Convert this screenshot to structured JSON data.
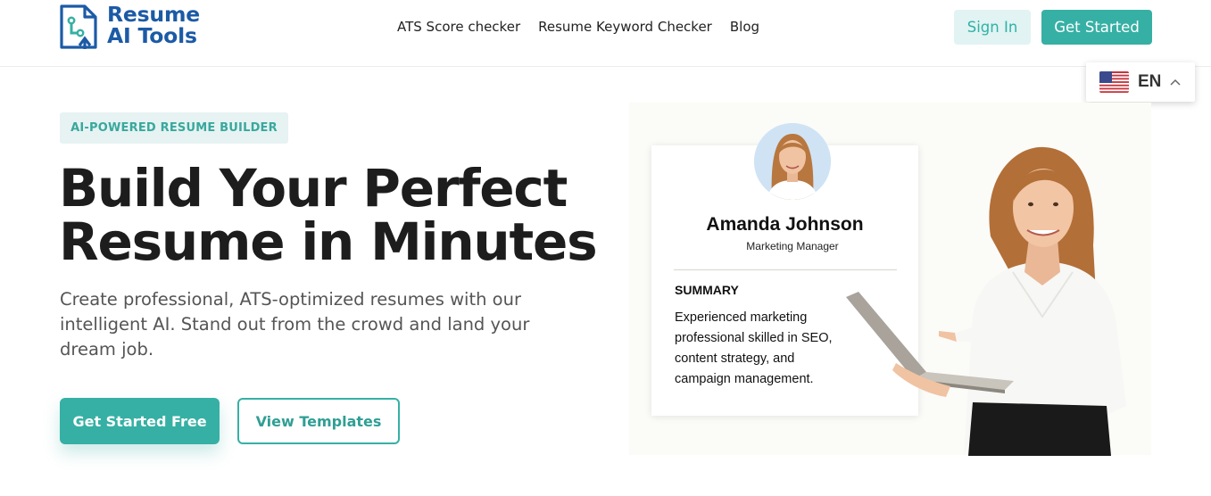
{
  "header": {
    "logo_line1": "Resume",
    "logo_line2": "AI Tools",
    "nav": [
      "ATS Score checker",
      "Resume Keyword Checker",
      "Blog"
    ],
    "sign_in": "Sign In",
    "get_started": "Get Started"
  },
  "language": {
    "code": "EN"
  },
  "hero": {
    "badge": "AI-POWERED RESUME BUILDER",
    "headline_line1": "Build Your Perfect",
    "headline_line2": "Resume in Minutes",
    "subtitle": "Create professional, ATS-optimized resumes with our intelligent AI. Stand out from the crowd and land your dream job.",
    "cta_primary": "Get Started Free",
    "cta_secondary": "View Templates"
  },
  "resume_card": {
    "name": "Amanda Johnson",
    "role": "Marketing Manager",
    "summary_heading": "SUMMARY",
    "summary_text": "Experienced marketing professional skilled in SEO, content strategy, and campaign management."
  },
  "colors": {
    "accent": "#36b0a4",
    "accent_light": "#e1f3f2",
    "logo_blue": "#1c5aa6",
    "headline": "#1d1d1d"
  }
}
